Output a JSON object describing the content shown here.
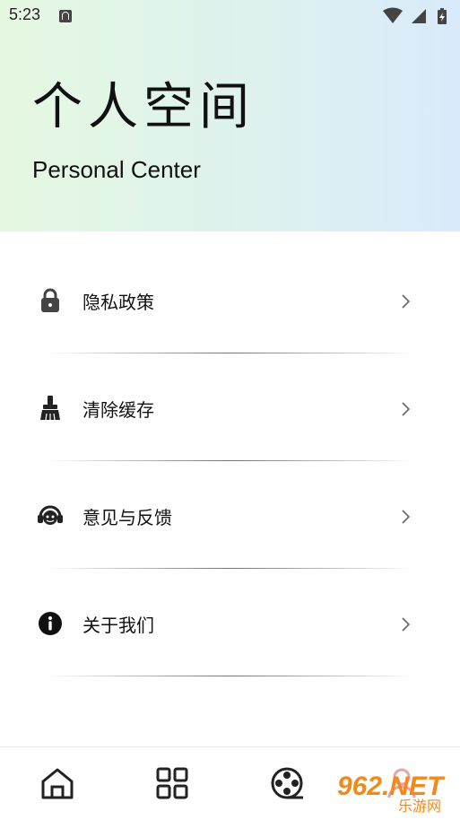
{
  "status_bar": {
    "time": "5:23",
    "icons": [
      "a-notification-icon",
      "wifi-icon",
      "signal-icon",
      "battery-icon"
    ]
  },
  "header": {
    "title_cn": "个人空间",
    "title_en": "Personal Center",
    "gradient_colors": [
      "#e6f8e1",
      "#d9eafa"
    ]
  },
  "menu": {
    "items": [
      {
        "label": "隐私政策",
        "icon": "lock-icon"
      },
      {
        "label": "清除缓存",
        "icon": "broom-icon"
      },
      {
        "label": "意见与反馈",
        "icon": "headset-icon"
      },
      {
        "label": "关于我们",
        "icon": "info-icon"
      }
    ]
  },
  "tabbar": {
    "tabs": [
      {
        "icon": "home-icon"
      },
      {
        "icon": "grid-icon"
      },
      {
        "icon": "film-reel-icon"
      },
      {
        "icon": "profile-icon"
      }
    ]
  },
  "watermark": {
    "text": "962.NET",
    "sub": "乐游网"
  }
}
